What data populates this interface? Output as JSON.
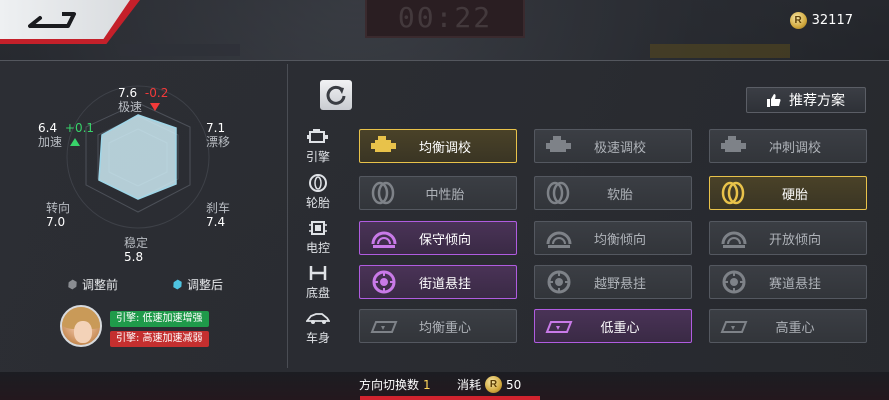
{
  "header": {
    "back_icon": "back-arrow-icon",
    "currency_icon": "coin-icon",
    "currency_amount": "32117",
    "coin_glyph": "R"
  },
  "stats": {
    "top": {
      "name": "极速",
      "value": "7.6",
      "delta": "-0.2"
    },
    "upper_left": {
      "name": "加速",
      "value": "6.4",
      "delta": "+0.1"
    },
    "upper_right": {
      "name": "漂移",
      "value": "7.1"
    },
    "lower_left": {
      "name": "转向",
      "value": "7.0"
    },
    "lower_right": {
      "name": "刹车",
      "value": "7.4"
    },
    "bottom": {
      "name": "稳定",
      "value": "5.8"
    },
    "legend_before": "调整前",
    "legend_after": "调整后",
    "colors": {
      "before": "#8a8d92",
      "after": "#4ec3e0",
      "up": "#38d36a",
      "down": "#f23a3a"
    }
  },
  "advisor": {
    "tag_positive": "引擎: 低速加速增强",
    "tag_negative": "引擎: 高速加速减弱"
  },
  "controls": {
    "refresh_icon": "refresh-icon",
    "recommend_label": "推荐方案",
    "recommend_icon": "thumbs-up-icon"
  },
  "categories": [
    {
      "label": "引擎",
      "icon": "engine-icon",
      "options": [
        {
          "label": "均衡调校",
          "state": "selected"
        },
        {
          "label": "极速调校",
          "state": "normal"
        },
        {
          "label": "冲刺调校",
          "state": "normal"
        }
      ]
    },
    {
      "label": "轮胎",
      "icon": "tire-icon",
      "options": [
        {
          "label": "中性胎",
          "state": "normal"
        },
        {
          "label": "软胎",
          "state": "normal"
        },
        {
          "label": "硬胎",
          "state": "selected"
        }
      ]
    },
    {
      "label": "电控",
      "icon": "chip-icon",
      "options": [
        {
          "label": "保守倾向",
          "state": "selected"
        },
        {
          "label": "均衡倾向",
          "state": "normal"
        },
        {
          "label": "开放倾向",
          "state": "normal"
        }
      ]
    },
    {
      "label": "底盘",
      "icon": "chassis-icon",
      "options": [
        {
          "label": "街道悬挂",
          "state": "selected"
        },
        {
          "label": "越野悬挂",
          "state": "normal"
        },
        {
          "label": "赛道悬挂",
          "state": "normal"
        }
      ]
    },
    {
      "label": "车身",
      "icon": "car-body-icon",
      "options": [
        {
          "label": "均衡重心",
          "state": "normal"
        },
        {
          "label": "低重心",
          "state": "selected"
        },
        {
          "label": "高重心",
          "state": "normal"
        }
      ]
    }
  ],
  "footer": {
    "switch_label": "方向切换数",
    "switch_count": "1",
    "cost_label": "消耗",
    "cost_amount": "50"
  }
}
